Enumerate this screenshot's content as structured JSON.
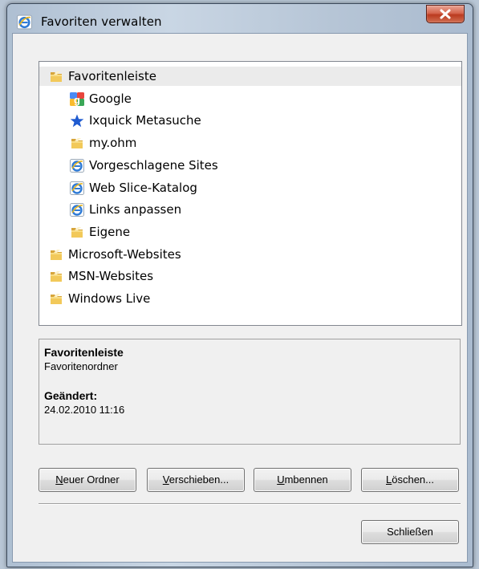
{
  "window": {
    "title": "Favoriten verwalten"
  },
  "tree": {
    "items": [
      {
        "label": "Favoritenleiste",
        "icon": "folder-icon",
        "level": 0,
        "selected": true
      },
      {
        "label": "Google",
        "icon": "google-icon",
        "level": 1
      },
      {
        "label": "Ixquick Metasuche",
        "icon": "star-icon",
        "level": 1
      },
      {
        "label": "my.ohm",
        "icon": "folder-icon",
        "level": 1
      },
      {
        "label": "Vorgeschlagene Sites",
        "icon": "ie-icon",
        "level": 1
      },
      {
        "label": "Web Slice-Katalog",
        "icon": "ie-icon",
        "level": 1
      },
      {
        "label": "Links anpassen",
        "icon": "ie-icon",
        "level": 1
      },
      {
        "label": "Eigene",
        "icon": "folder-icon",
        "level": 1
      },
      {
        "label": "Microsoft-Websites",
        "icon": "folder-icon",
        "level": 0
      },
      {
        "label": "MSN-Websites",
        "icon": "folder-icon",
        "level": 0
      },
      {
        "label": "Windows Live",
        "icon": "folder-icon",
        "level": 0
      }
    ]
  },
  "details": {
    "name": "Favoritenleiste",
    "type": "Favoritenordner",
    "modified_label": "Geändert:",
    "modified_value": "24.02.2010 11:16"
  },
  "buttons": {
    "new_folder": {
      "accel": "N",
      "rest": "euer Ordner"
    },
    "move": {
      "accel": "V",
      "rest": "erschieben..."
    },
    "rename": {
      "accel": "U",
      "rest": "mbennen"
    },
    "delete": {
      "accel": "L",
      "rest": "öschen..."
    },
    "close": "Schließen"
  },
  "colors": {
    "selection": "#ebebeb",
    "folder": "#e9b949",
    "star": "#1f5bd0",
    "ie": "#2f7bd6"
  }
}
